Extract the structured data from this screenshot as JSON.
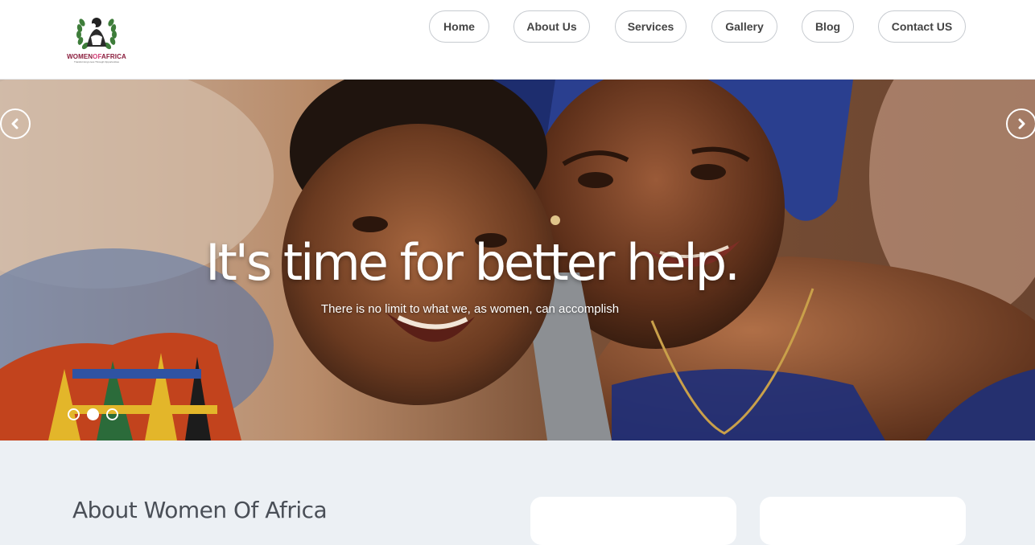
{
  "header": {
    "logo": {
      "name_part1": "WOMEN",
      "name_part2": "OF",
      "name_part3": "AFRICA",
      "tagline": "Transforming Lives Through Opportunities"
    },
    "nav": [
      {
        "label": "Home"
      },
      {
        "label": "About Us"
      },
      {
        "label": "Services"
      },
      {
        "label": "Gallery"
      },
      {
        "label": "Blog"
      },
      {
        "label": "Contact US"
      }
    ]
  },
  "hero": {
    "title": "It's time for better help.",
    "subtitle": "There is no limit to what we, as women, can accomplish",
    "prev_icon": "chevron-left-icon",
    "next_icon": "chevron-right-icon",
    "slides": 3,
    "active_slide": 2
  },
  "about": {
    "title": "About Women Of Africa"
  },
  "colors": {
    "brand_primary": "#8a1c3c",
    "brand_accent": "#d33a74",
    "section_bg": "#ecf0f4"
  }
}
